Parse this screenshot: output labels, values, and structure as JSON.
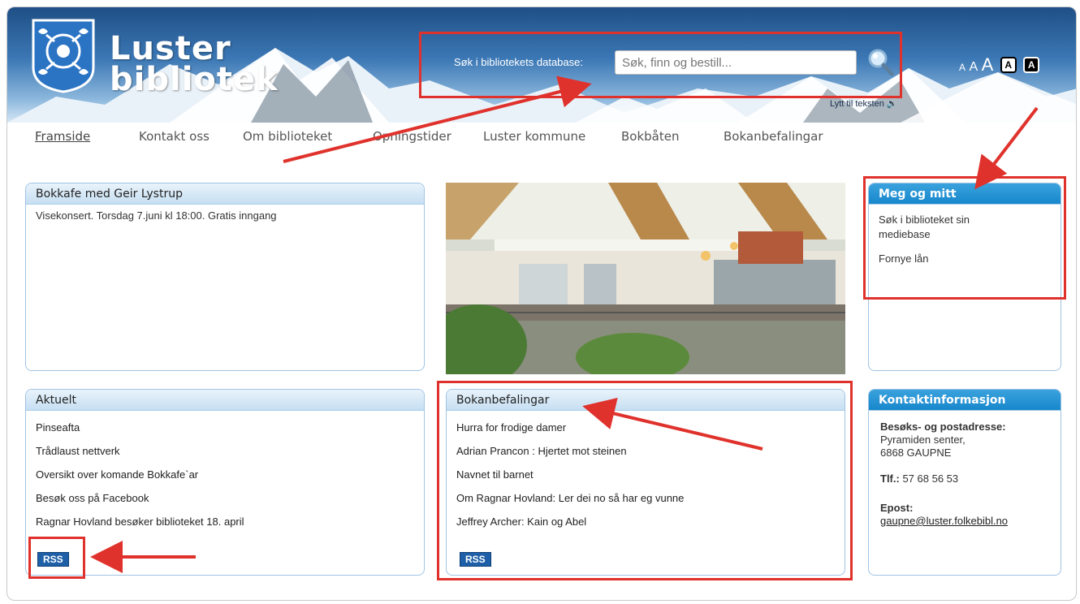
{
  "header": {
    "logo_line1": "Luster",
    "logo_line2": "bibliotek",
    "search_label": "Søk i bibliotekets database:",
    "search_placeholder": "Søk, finn og bestill...",
    "font_sizes": [
      "A",
      "A",
      "A"
    ],
    "contrast_light": "A",
    "contrast_dark": "A",
    "listen_link": "Lytt til teksten"
  },
  "nav": {
    "items": [
      "Framside",
      "Kontakt oss",
      "Om biblioteket",
      "Opningstider",
      "Luster kommune",
      "Bokbåten",
      "Bokanbefalingar"
    ],
    "active": "Framside"
  },
  "bokkafe": {
    "title": "Bokkafe med Geir Lystrup",
    "text": "Visekonsert. Torsdag 7.juni kl 18:00. Gratis inngang"
  },
  "meg_og_mitt": {
    "title": "Meg og mitt",
    "links": [
      "Søk i biblioteket sin mediebase",
      "Fornye lån"
    ]
  },
  "aktuelt": {
    "title": "Aktuelt",
    "links": [
      "Pinseafta",
      "Trådlaust nettverk",
      "Oversikt over komande Bokkafe`ar",
      "Besøk oss på Facebook",
      "Ragnar Hovland besøker biblioteket 18. april"
    ],
    "rss": "RSS"
  },
  "bokanbefalingar": {
    "title": "Bokanbefalingar",
    "links": [
      "Hurra for frodige damer",
      "Adrian Prancon : Hjertet mot steinen",
      "Navnet til barnet",
      "Om Ragnar Hovland: Ler dei no så har eg vunne",
      "Jeffrey Archer: Kain og Abel"
    ],
    "rss": "RSS"
  },
  "kontakt": {
    "title": "Kontaktinformasjon",
    "address_label": "Besøks- og postadresse:",
    "address_line1": "Pyramiden senter,",
    "address_line2": "6868 GAUPNE",
    "phone_label": "Tlf.:",
    "phone": "57 68 56 53",
    "email_label": "Epost:",
    "email": "gaupne@luster.folkebibl.no"
  },
  "colors": {
    "accent": "#1787cc",
    "annotation": "#e0322c",
    "panel_border": "#9fc4e4"
  }
}
